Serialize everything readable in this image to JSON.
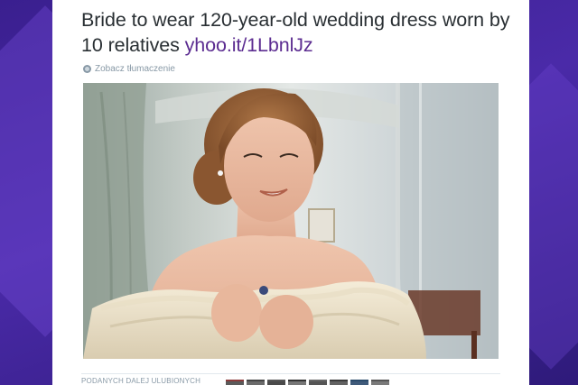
{
  "tweet": {
    "text": "Bride to wear 120-year-old wedding dress worn by 10 relatives",
    "link": "yhoo.it/1LbnlJz",
    "translate_label": "Zobacz tłumaczenie"
  },
  "photo": {
    "alt": "Bride in a vintage lace wedding dress"
  },
  "stats": {
    "label": "PODANYCH DALEJ   ULUBIONYCH"
  },
  "colors": {
    "link": "#5c2d91",
    "text": "#292f33",
    "muted": "#8899a6",
    "background": "#3a1f8f"
  },
  "icons": {
    "translate": "globe-icon"
  }
}
